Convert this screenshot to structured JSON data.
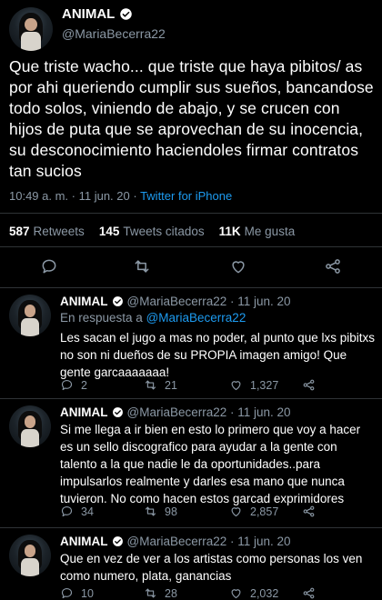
{
  "main_tweet": {
    "display_name": "ANIMAL",
    "handle": "@MariaBecerra22",
    "text": "Que triste wacho... que triste que haya pibitos/ as por ahi queriendo cumplir sus sueños, bancandose todo solos, viniendo de abajo, y se crucen con hijos de puta que se aprovechan de su inocencia, su desconocimiento haciendoles firmar contratos tan sucios",
    "time": "10:49 a. m. · 11 jun. 20 ·",
    "source": "Twitter for iPhone",
    "retweets_count": "587",
    "retweets_label": "Retweets",
    "quotes_count": "145",
    "quotes_label": "Tweets citados",
    "likes_count": "11K",
    "likes_label": "Me gusta"
  },
  "replies": [
    {
      "display_name": "ANIMAL",
      "handle": "@MariaBecerra22 · 11 jun. 20",
      "in_reply_prefix": "En respuesta a",
      "in_reply_mention": "@MariaBecerra22",
      "text": "Les sacan el jugo a mas no poder, al punto que lxs pibitxs no son ni dueños de su PROPIA imagen amigo! Que gente garcaaaaaaa!",
      "replies": "2",
      "retweets": "21",
      "likes": "1,327"
    },
    {
      "display_name": "ANIMAL",
      "handle": "@MariaBecerra22 · 11 jun. 20",
      "text": "Si me llega a ir bien en esto lo primero que voy a hacer es un sello discografico para ayudar a la gente con talento a la que nadie le da oportunidades..para impulsarlos realmente y darles esa mano que nunca tuvieron. No como hacen estos garcad exprimidores",
      "replies": "34",
      "retweets": "98",
      "likes": "2,857"
    },
    {
      "display_name": "ANIMAL",
      "handle": "@MariaBecerra22 · 11 jun. 20",
      "text": "Que en vez de ver a los artistas como personas los ven como numero, plata, ganancias",
      "replies": "10",
      "retweets": "28",
      "likes": "2,032"
    }
  ],
  "colors": {
    "background": "#000000",
    "text_primary": "#ffffff",
    "text_secondary": "#8b98a5",
    "accent": "#1d9bf0",
    "divider": "#2f3336"
  },
  "icons": [
    "verified-badge-icon",
    "reply-icon",
    "retweet-icon",
    "like-icon",
    "share-icon"
  ]
}
